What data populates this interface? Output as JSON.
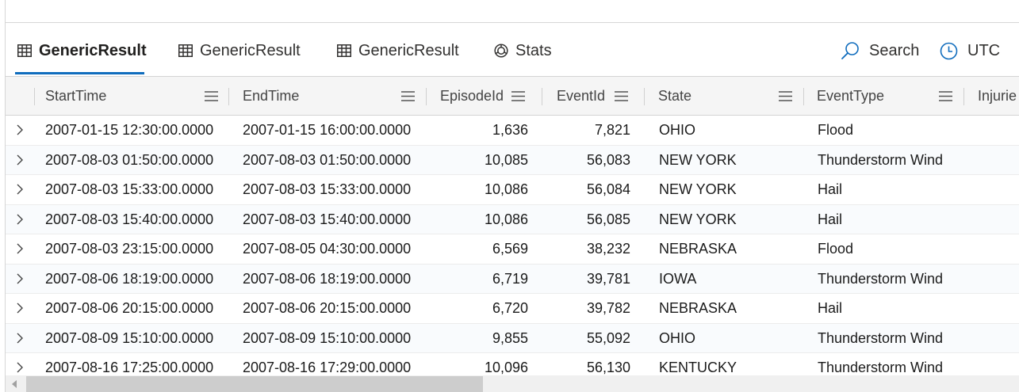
{
  "tabs": [
    {
      "label": "GenericResult",
      "icon": "table-icon",
      "active": true
    },
    {
      "label": "GenericResult",
      "icon": "table-icon",
      "active": false
    },
    {
      "label": "GenericResult",
      "icon": "table-icon",
      "active": false
    },
    {
      "label": "Stats",
      "icon": "stats-icon",
      "active": false
    }
  ],
  "toolbar": {
    "search_label": "Search",
    "search_icon": "search-icon",
    "timezone_label": "UTC",
    "timezone_icon": "clock-icon"
  },
  "columns": [
    "StartTime",
    "EndTime",
    "EpisodeId",
    "EventId",
    "State",
    "EventType",
    "Injurie"
  ],
  "rows": [
    {
      "StartTime": "2007-01-15 12:30:00.0000",
      "EndTime": "2007-01-15 16:00:00.0000",
      "EpisodeId": "1,636",
      "EventId": "7,821",
      "State": "OHIO",
      "EventType": "Flood"
    },
    {
      "StartTime": "2007-08-03 01:50:00.0000",
      "EndTime": "2007-08-03 01:50:00.0000",
      "EpisodeId": "10,085",
      "EventId": "56,083",
      "State": "NEW YORK",
      "EventType": "Thunderstorm Wind"
    },
    {
      "StartTime": "2007-08-03 15:33:00.0000",
      "EndTime": "2007-08-03 15:33:00.0000",
      "EpisodeId": "10,086",
      "EventId": "56,084",
      "State": "NEW YORK",
      "EventType": "Hail"
    },
    {
      "StartTime": "2007-08-03 15:40:00.0000",
      "EndTime": "2007-08-03 15:40:00.0000",
      "EpisodeId": "10,086",
      "EventId": "56,085",
      "State": "NEW YORK",
      "EventType": "Hail"
    },
    {
      "StartTime": "2007-08-03 23:15:00.0000",
      "EndTime": "2007-08-05 04:30:00.0000",
      "EpisodeId": "6,569",
      "EventId": "38,232",
      "State": "NEBRASKA",
      "EventType": "Flood"
    },
    {
      "StartTime": "2007-08-06 18:19:00.0000",
      "EndTime": "2007-08-06 18:19:00.0000",
      "EpisodeId": "6,719",
      "EventId": "39,781",
      "State": "IOWA",
      "EventType": "Thunderstorm Wind"
    },
    {
      "StartTime": "2007-08-06 20:15:00.0000",
      "EndTime": "2007-08-06 20:15:00.0000",
      "EpisodeId": "6,720",
      "EventId": "39,782",
      "State": "NEBRASKA",
      "EventType": "Hail"
    },
    {
      "StartTime": "2007-08-09 15:10:00.0000",
      "EndTime": "2007-08-09 15:10:00.0000",
      "EpisodeId": "9,855",
      "EventId": "55,092",
      "State": "OHIO",
      "EventType": "Thunderstorm Wind"
    },
    {
      "StartTime": "2007-08-16 17:25:00.0000",
      "EndTime": "2007-08-16 17:29:00.0000",
      "EpisodeId": "10,096",
      "EventId": "56,130",
      "State": "KENTUCKY",
      "EventType": "Thunderstorm Wind"
    }
  ],
  "colors": {
    "accent": "#0f6cbd",
    "header_bg": "#f5f5f5",
    "scroll_thumb": "#cdcdcd"
  }
}
